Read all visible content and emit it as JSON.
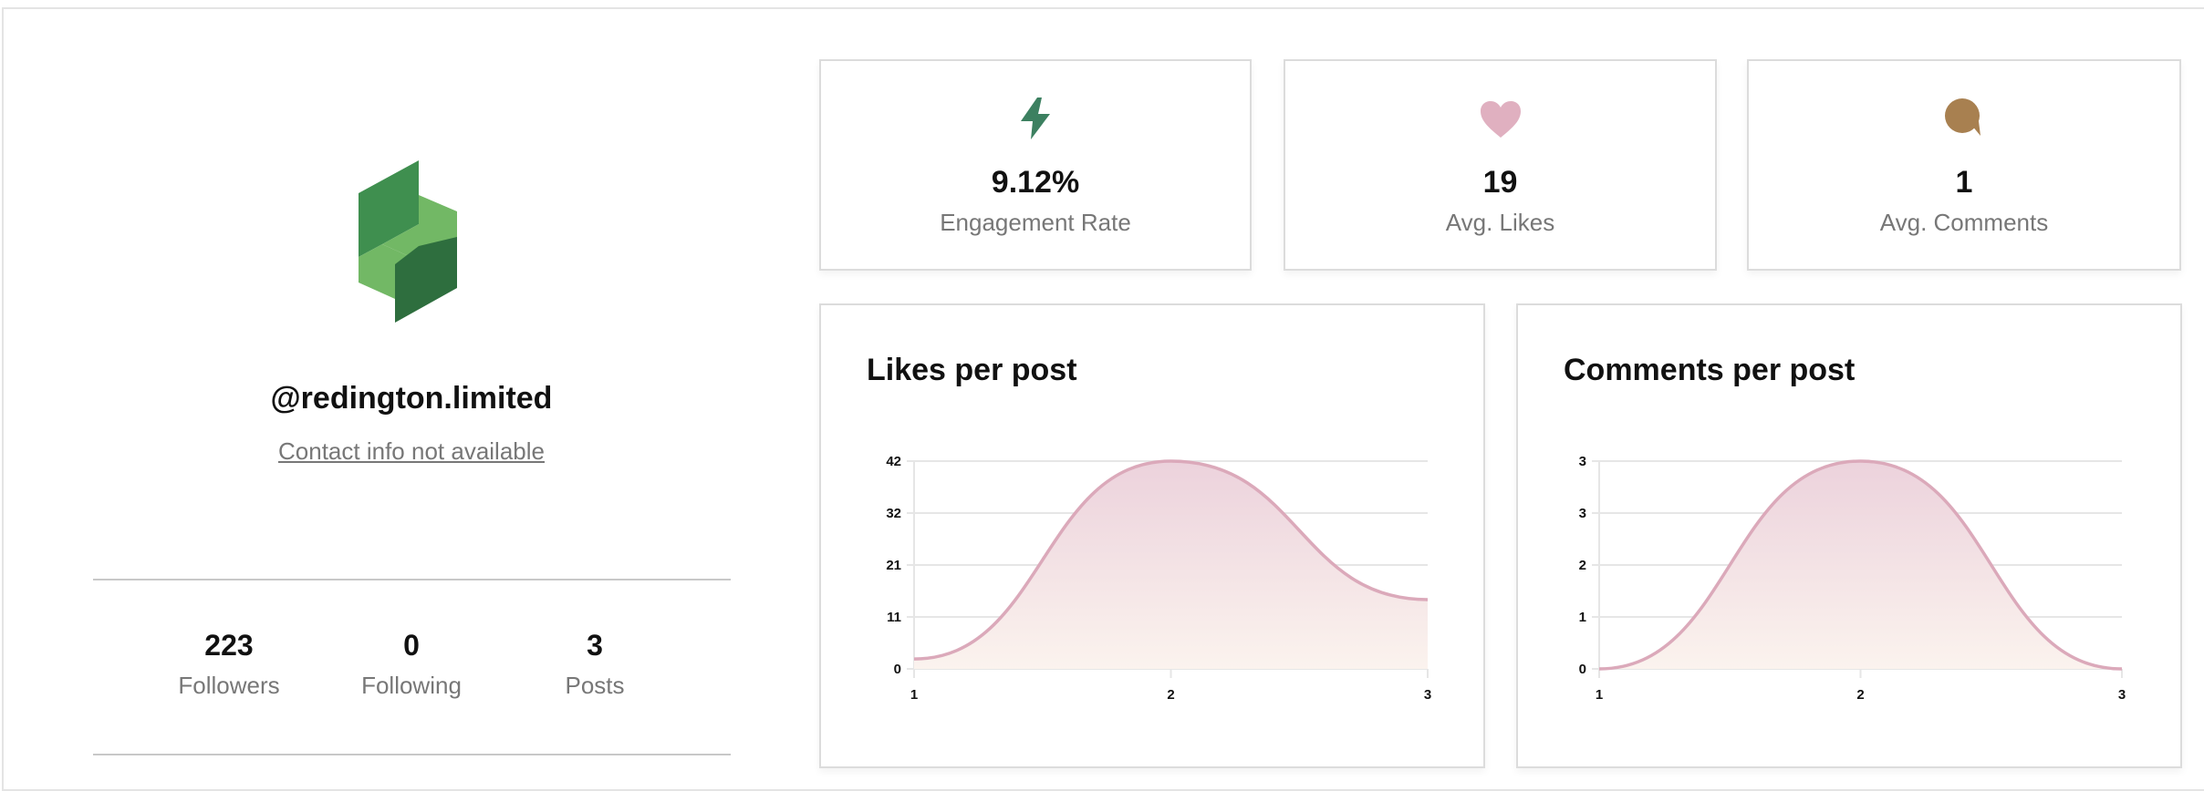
{
  "profile": {
    "handle": "@redington.limited",
    "contact": "Contact info not available",
    "stats": [
      {
        "value": "223",
        "label": "Followers"
      },
      {
        "value": "0",
        "label": "Following"
      },
      {
        "value": "3",
        "label": "Posts"
      }
    ]
  },
  "metrics": [
    {
      "icon": "lightning-icon",
      "color": "#3c8060",
      "value": "9.12%",
      "label": "Engagement Rate"
    },
    {
      "icon": "heart-icon",
      "color": "#e0b0c0",
      "value": "19",
      "label": "Avg. Likes"
    },
    {
      "icon": "comment-icon",
      "color": "#a88050",
      "value": "1",
      "label": "Avg. Comments"
    }
  ],
  "colors": {
    "line": "#dba9ba",
    "fill_top": "#ecd2dc",
    "fill_bottom": "#fbf3ee",
    "logo_dark": "#2e6e3e",
    "logo_mid": "#3f8f4f",
    "logo_light": "#72b865"
  },
  "chart_data": [
    {
      "type": "area",
      "title": "Likes per post",
      "x": [
        1,
        2,
        3
      ],
      "values": [
        2,
        42,
        14
      ],
      "yticks": [
        "0",
        "11",
        "21",
        "32",
        "42"
      ],
      "ylim": [
        0,
        42
      ],
      "xticks": [
        "1",
        "2",
        "3"
      ],
      "grid": true
    },
    {
      "type": "area",
      "title": "Comments per post",
      "x": [
        1,
        2,
        3
      ],
      "values": [
        0,
        3,
        0
      ],
      "yticks": [
        "0",
        "1",
        "2",
        "3",
        "3"
      ],
      "ylim": [
        0,
        3
      ],
      "xticks": [
        "1",
        "2",
        "3"
      ],
      "grid": true
    }
  ]
}
